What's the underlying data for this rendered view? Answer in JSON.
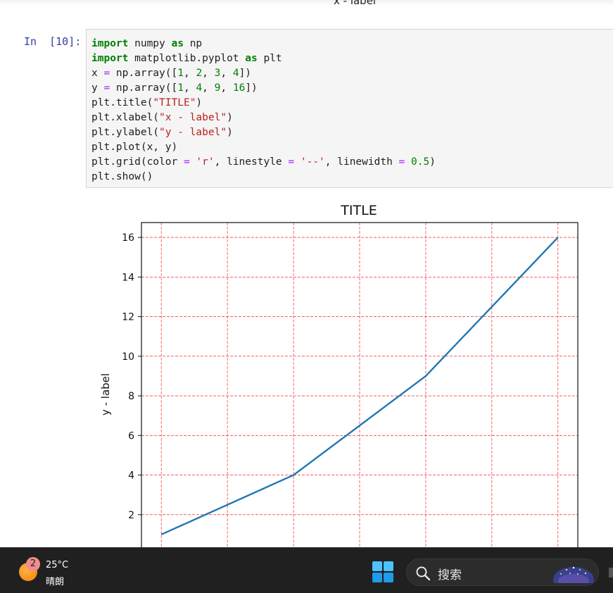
{
  "previous_output": {
    "xlabel_fragment": "x - label"
  },
  "cell": {
    "prompt": "In  [10]:",
    "code_lines": [
      [
        {
          "t": "import",
          "c": "kw"
        },
        {
          "t": " numpy "
        },
        {
          "t": "as",
          "c": "kw"
        },
        {
          "t": " np"
        }
      ],
      [
        {
          "t": "import",
          "c": "kw"
        },
        {
          "t": " matplotlib.pyplot "
        },
        {
          "t": "as",
          "c": "kw"
        },
        {
          "t": " plt"
        }
      ],
      [
        {
          "t": "x "
        },
        {
          "t": "=",
          "c": "op"
        },
        {
          "t": " np.array(["
        },
        {
          "t": "1",
          "c": "num"
        },
        {
          "t": ", "
        },
        {
          "t": "2",
          "c": "num"
        },
        {
          "t": ", "
        },
        {
          "t": "3",
          "c": "num"
        },
        {
          "t": ", "
        },
        {
          "t": "4",
          "c": "num"
        },
        {
          "t": "])"
        }
      ],
      [
        {
          "t": "y "
        },
        {
          "t": "=",
          "c": "op"
        },
        {
          "t": " np.array(["
        },
        {
          "t": "1",
          "c": "num"
        },
        {
          "t": ", "
        },
        {
          "t": "4",
          "c": "num"
        },
        {
          "t": ", "
        },
        {
          "t": "9",
          "c": "num"
        },
        {
          "t": ", "
        },
        {
          "t": "16",
          "c": "num"
        },
        {
          "t": "])"
        }
      ],
      [
        {
          "t": "plt.title("
        },
        {
          "t": "\"TITLE\"",
          "c": "str"
        },
        {
          "t": ")"
        }
      ],
      [
        {
          "t": "plt.xlabel("
        },
        {
          "t": "\"x - label\"",
          "c": "str"
        },
        {
          "t": ")"
        }
      ],
      [
        {
          "t": "plt.ylabel("
        },
        {
          "t": "\"y - label\"",
          "c": "str"
        },
        {
          "t": ")"
        }
      ],
      [
        {
          "t": "plt.plot(x, y)"
        }
      ],
      [
        {
          "t": "plt.grid(color "
        },
        {
          "t": "=",
          "c": "op"
        },
        {
          "t": " "
        },
        {
          "t": "'r'",
          "c": "str"
        },
        {
          "t": ", linestyle "
        },
        {
          "t": "=",
          "c": "op"
        },
        {
          "t": " "
        },
        {
          "t": "'--'",
          "c": "str"
        },
        {
          "t": ", linewidth "
        },
        {
          "t": "=",
          "c": "op"
        },
        {
          "t": " "
        },
        {
          "t": "0.5",
          "c": "num"
        },
        {
          "t": ")"
        }
      ],
      [
        {
          "t": "plt.show()"
        }
      ]
    ]
  },
  "chart_data": {
    "type": "line",
    "title": "TITLE",
    "xlabel": "",
    "ylabel": "y - label",
    "x": [
      1,
      2,
      3,
      4
    ],
    "series": [
      {
        "values": [
          1,
          4,
          9,
          16
        ],
        "color": "#1f77b4"
      }
    ],
    "xlim": [
      0.85,
      4.15
    ],
    "ylim": [
      0.25,
      16.75
    ],
    "y_ticks": [
      2,
      4,
      6,
      8,
      10,
      12,
      14,
      16
    ],
    "x_grid": [
      1.0,
      1.5,
      2.0,
      2.5,
      3.0,
      3.5,
      4.0
    ],
    "grid": true,
    "grid_color": "#ff0000",
    "grid_linestyle": "dashed"
  },
  "taskbar": {
    "weather_badge": "2",
    "temperature": "25°C",
    "condition": "晴朗",
    "search_text": "搜索"
  },
  "colors": {
    "taskbar_bg": "#202020",
    "prompt": "#303f9f",
    "keyword": "#008000",
    "string": "#ba2121"
  }
}
